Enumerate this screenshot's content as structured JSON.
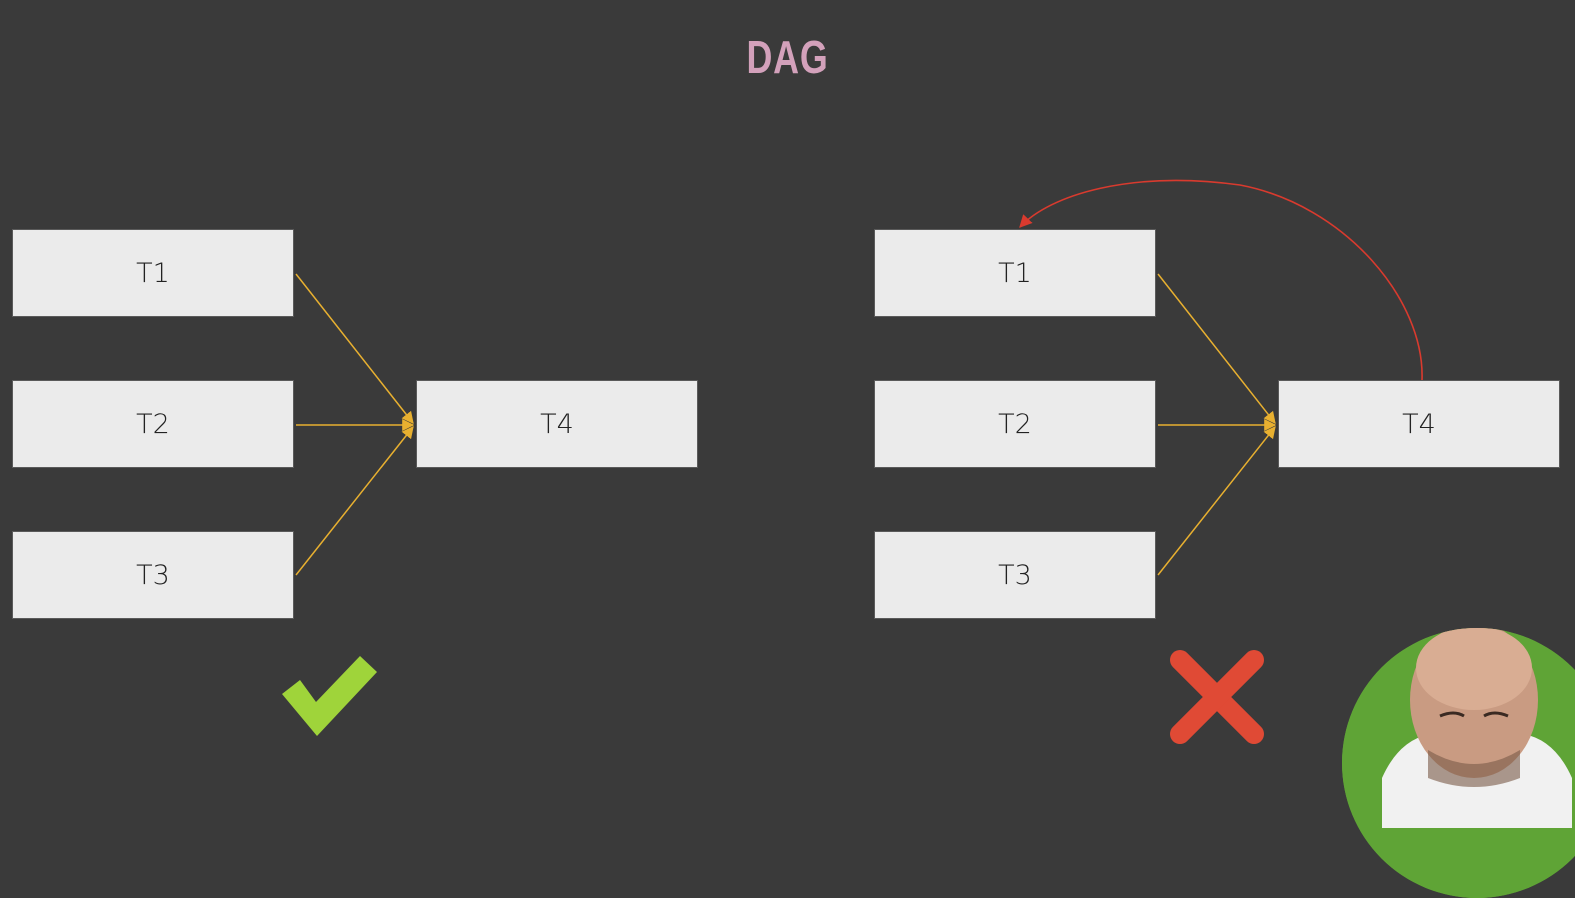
{
  "title": "DAG",
  "left_graph": {
    "nodes": {
      "t1": "T1",
      "t2": "T2",
      "t3": "T3",
      "t4": "T4"
    },
    "verdict": "valid",
    "verdict_icon": "checkmark-icon"
  },
  "right_graph": {
    "nodes": {
      "t1": "T1",
      "t2": "T2",
      "t3": "T3",
      "t4": "T4"
    },
    "verdict": "invalid",
    "verdict_icon": "cross-icon",
    "cycle_edge": "T4 -> T1"
  },
  "colors": {
    "background": "#3a3a3a",
    "title": "#d3a1bb",
    "node": "#ebebeb",
    "edge": "#e8b030",
    "cycle_edge": "#d93a2e",
    "check": "#9fd43a",
    "cross": "#e04a35"
  }
}
